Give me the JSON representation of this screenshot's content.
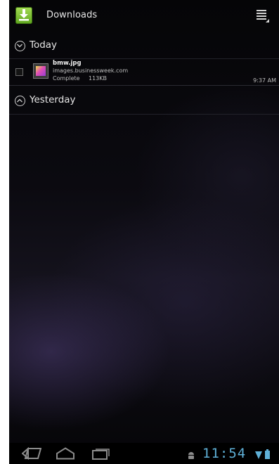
{
  "action_bar": {
    "title": "Downloads"
  },
  "groups": [
    {
      "label": "Today"
    },
    {
      "label": "Yesterday"
    }
  ],
  "downloads": [
    {
      "file_name": "bmw.jpg",
      "host": "images.businessweek.com",
      "status": "Complete",
      "size": "113KB",
      "time": "9:37 AM"
    }
  ],
  "status_bar": {
    "clock": "11:54"
  },
  "icons": {
    "app": "download-icon",
    "overflow": "overflow-menu-icon",
    "group_toggle": "circle-chevron-icon",
    "back": "back-icon",
    "home": "home-icon",
    "recents": "recent-apps-icon",
    "debug": "android-debug-icon",
    "wifi": "wifi-signal-icon",
    "battery": "battery-icon"
  },
  "colors": {
    "clock": "#5fb1d8",
    "app_icon": "#7fc23a",
    "background": "#0a090e"
  }
}
